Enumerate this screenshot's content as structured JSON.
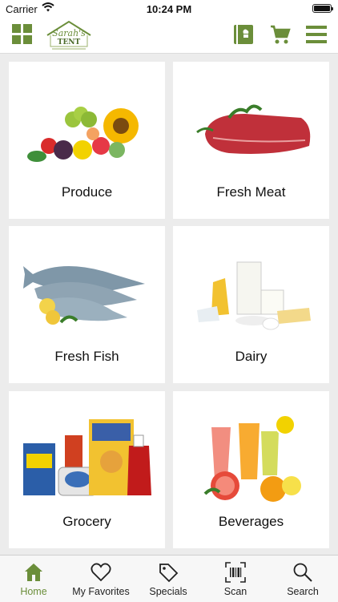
{
  "status_bar": {
    "carrier": "Carrier",
    "time": "10:24 PM"
  },
  "brand": {
    "logo_text": "Sarah's",
    "logo_sub": "TENT",
    "accent": "#6b8e3a"
  },
  "header": {
    "icons": [
      "grid-icon",
      "recipe-book-icon",
      "cart-icon",
      "menu-icon"
    ]
  },
  "categories": [
    {
      "label": "Produce"
    },
    {
      "label": "Fresh Meat"
    },
    {
      "label": "Fresh Fish"
    },
    {
      "label": "Dairy"
    },
    {
      "label": "Grocery"
    },
    {
      "label": "Beverages"
    }
  ],
  "tabs": [
    {
      "label": "Home",
      "icon": "home-icon",
      "active": true
    },
    {
      "label": "My Favorites",
      "icon": "heart-icon",
      "active": false
    },
    {
      "label": "Specials",
      "icon": "tag-icon",
      "active": false
    },
    {
      "label": "Scan",
      "icon": "barcode-icon",
      "active": false
    },
    {
      "label": "Search",
      "icon": "search-icon",
      "active": false
    }
  ],
  "colors": {
    "accent": "#6b8e3a",
    "background": "#ececec",
    "tile": "#ffffff"
  }
}
